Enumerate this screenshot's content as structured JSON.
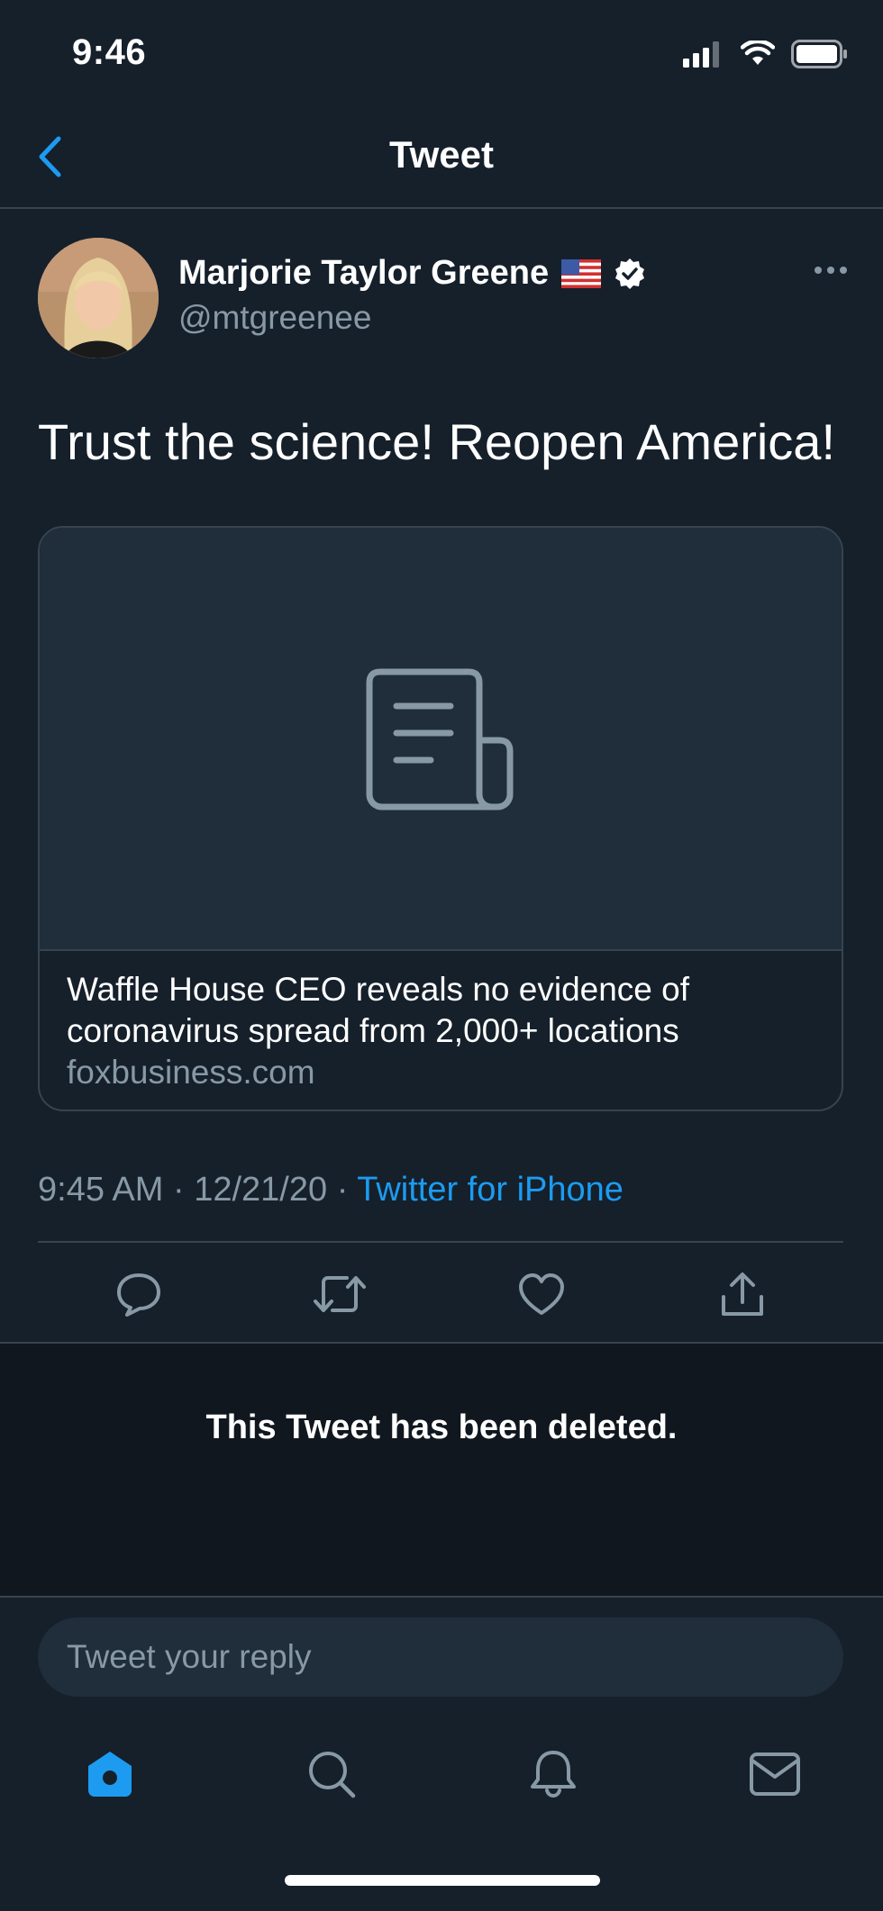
{
  "status_bar": {
    "time": "9:46"
  },
  "header": {
    "title": "Tweet"
  },
  "tweet": {
    "author_name": "Marjorie Taylor Greene",
    "author_handle": "@mtgreenee",
    "text": "Trust the science! Reopen America!",
    "card": {
      "title": "Waffle House CEO reveals no evidence of coronavirus spread from 2,000+ locations",
      "domain": "foxbusiness.com"
    },
    "time": "9:45 AM",
    "date": "12/21/20",
    "source": "Twitter for iPhone"
  },
  "deleted_notice": "This Tweet has been deleted.",
  "reply": {
    "placeholder": "Tweet your reply"
  },
  "colors": {
    "accent": "#1d9bf0",
    "background": "#15202b",
    "secondary_text": "#8899a6"
  },
  "icons": {
    "action_bar": [
      "reply-icon",
      "retweet-icon",
      "like-icon",
      "share-icon"
    ],
    "tab_bar": [
      "home-icon",
      "search-icon",
      "notifications-icon",
      "messages-icon"
    ]
  }
}
